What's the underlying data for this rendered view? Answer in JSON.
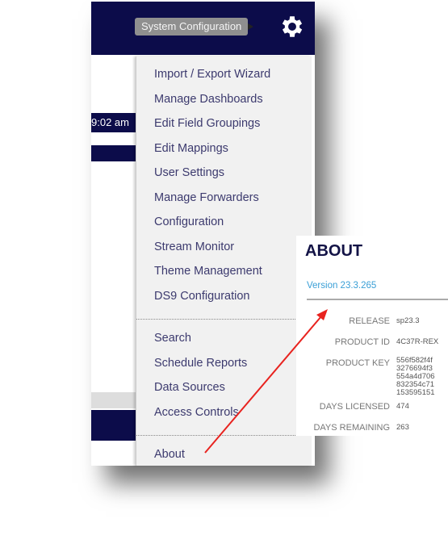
{
  "header": {
    "tooltip": "System Configuration",
    "icon": "gear-icon"
  },
  "background": {
    "time": "9:02 am"
  },
  "menu": {
    "group1": [
      "Import / Export Wizard",
      "Manage Dashboards",
      "Edit Field Groupings",
      "Edit Mappings",
      "User Settings",
      "Manage Forwarders",
      "Configuration",
      "Stream Monitor",
      "Theme Management",
      "DS9 Configuration"
    ],
    "group2": [
      "Search",
      "Schedule Reports",
      "Data Sources",
      "Access Controls"
    ],
    "group3": [
      "About"
    ]
  },
  "about": {
    "title": "ABOUT",
    "version": "Version 23.3.265",
    "rows": [
      {
        "label": "RELEASE",
        "value": "sp23.3"
      },
      {
        "label": "PRODUCT ID",
        "value": "4C37R-REX"
      },
      {
        "label": "PRODUCT KEY",
        "value": "556f582f4f\n3276694f3\n554a4d706\n832354c71\n153595151"
      },
      {
        "label": "DAYS LICENSED",
        "value": "474"
      },
      {
        "label": "DAYS REMAINING",
        "value": "263"
      }
    ]
  },
  "colors": {
    "navy": "#0c0c4a",
    "menu_text": "#3c3a6e",
    "version": "#3a9fd6",
    "arrow": "#e8231f"
  }
}
